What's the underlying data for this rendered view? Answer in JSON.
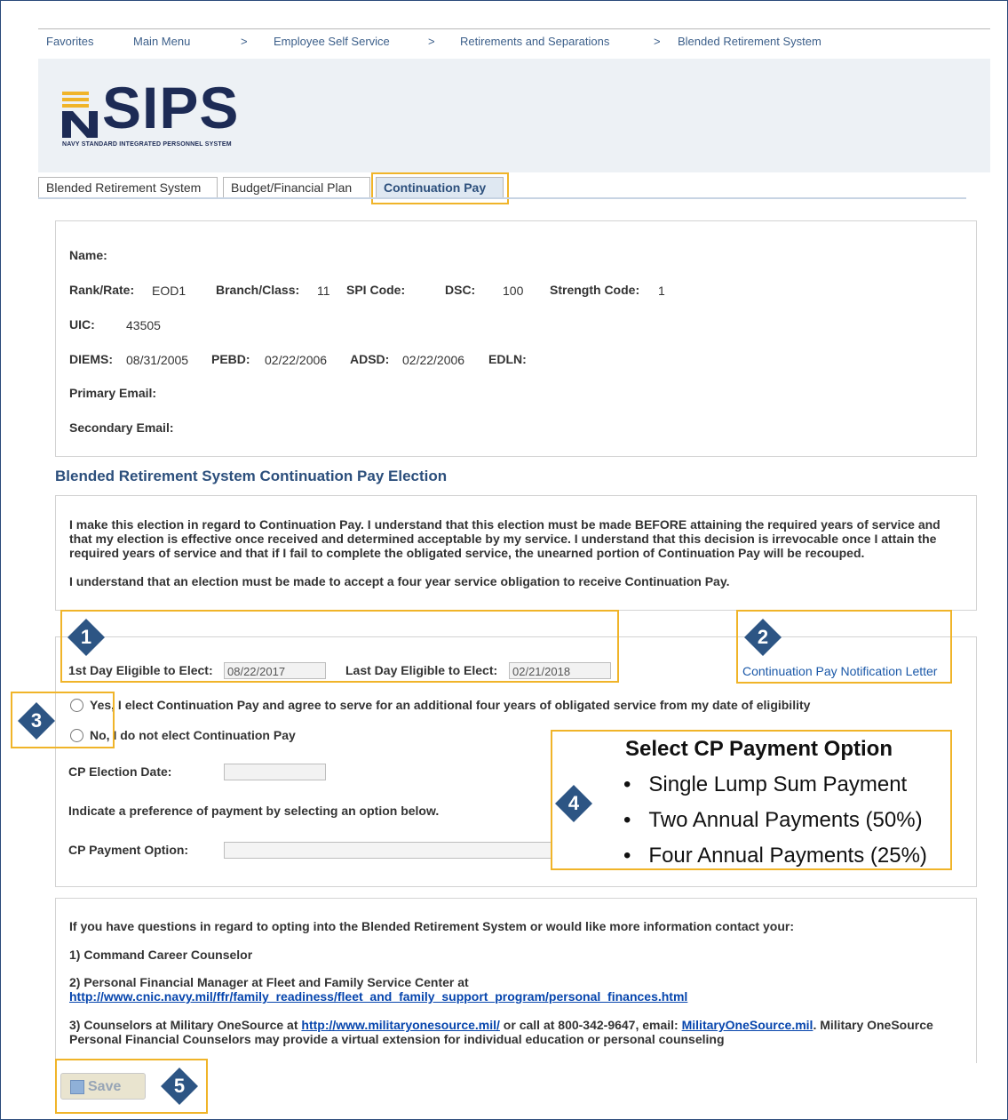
{
  "breadcrumb": {
    "items": [
      "Favorites",
      "Main Menu",
      "Employee Self Service",
      "Retirements and Separations",
      "Blended Retirement System"
    ],
    "separator": ">"
  },
  "logo": {
    "text": "SIPS",
    "subtitle": "NAVY STANDARD INTEGRATED PERSONNEL SYSTEM"
  },
  "tabs": [
    {
      "label": "Blended Retirement System"
    },
    {
      "label": "Budget/Financial Plan"
    },
    {
      "label": "Continuation Pay"
    }
  ],
  "member": {
    "name_label": "Name:",
    "rank_label": "Rank/Rate:",
    "rank_value": "EOD1",
    "branch_label": "Branch/Class:",
    "branch_value": "11",
    "spi_label": "SPI Code:",
    "dsc_label": "DSC:",
    "dsc_value": "100",
    "strength_label": "Strength Code:",
    "strength_value": "1",
    "uic_label": "UIC:",
    "uic_value": "43505",
    "diems_label": "DIEMS:",
    "diems_value": "08/31/2005",
    "pebd_label": "PEBD:",
    "pebd_value": "02/22/2006",
    "adsd_label": "ADSD:",
    "adsd_value": "02/22/2006",
    "edln_label": "EDLN:",
    "primary_email_label": "Primary Email:",
    "secondary_email_label": "Secondary Email:"
  },
  "election": {
    "section_title": "Blended Retirement System Continuation Pay Election",
    "statement_1": "I make this election in regard to Continuation Pay. I understand that this election must be made BEFORE attaining the required years of service and that my election is effective once received and determined acceptable by my service. I understand that this decision is irrevocable once I attain the required years of service and that if I fail to complete the obligated service, the unearned portion of Continuation Pay will be recouped.",
    "statement_2": "I understand that an election must be made to accept a four year service obligation to receive Continuation Pay.",
    "first_day_label": "1st Day Eligible to Elect:",
    "first_day_value": "08/22/2017",
    "last_day_label": "Last Day Eligible to Elect:",
    "last_day_value": "02/21/2018",
    "letter_link": "Continuation Pay Notification Letter",
    "yes_option": "Yes, I elect Continuation Pay and agree to serve for an additional four years of obligated service from my date of eligibility",
    "no_option": "No, I do not elect Continuation Pay",
    "date_label": "CP Election Date:",
    "preference_text": "Indicate a preference of payment by selecting an option below.",
    "payment_label": "CP Payment Option:"
  },
  "callout_options": {
    "title": "Select CP Payment Option",
    "items": [
      "Single Lump Sum Payment",
      "Two Annual Payments (50%)",
      "Four Annual Payments (25%)"
    ]
  },
  "info": {
    "intro": "If you have questions in regard to opting into the Blended Retirement System or would like more information contact your:",
    "item1": "1) Command Career Counselor",
    "item2_text": "2) Personal Financial Manager at Fleet and Family Service Center at",
    "item2_link": "http://www.cnic.navy.mil/ffr/family_readiness/fleet_and_family_support_program/personal_finances.html",
    "item3_a": "3) Counselors at Military OneSource at ",
    "item3_link": "http://www.militaryonesource.mil/",
    "item3_b": " or call at 800-342-9647, email: ",
    "item3_email": "MilitaryOneSource.mil",
    "item3_c": ". Military OneSource Personal Financial Counselors may provide a virtual extension for individual education or personal counseling"
  },
  "save_label": "Save",
  "badges": [
    "1",
    "2",
    "3",
    "4",
    "5"
  ],
  "colors": {
    "callout": "#f0b429",
    "badge": "#2d5584",
    "section_title": "#2c4f7c"
  }
}
